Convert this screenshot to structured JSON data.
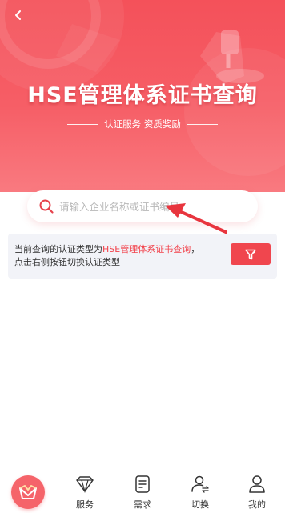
{
  "header": {
    "title": "HSE管理体系证书查询",
    "subtitle": "认证服务 资质奖励",
    "back_icon": "back-arrow-icon"
  },
  "search": {
    "placeholder": "请输入企业名称或证书编号",
    "value": ""
  },
  "notice": {
    "prefix": "当前查询的认证类型为",
    "highlight": "HSE管理体系证书查询",
    "suffix": "，",
    "line2": "点击右侧按钮切换认证类型",
    "filter_icon": "filter-icon"
  },
  "tabbar": {
    "items": [
      {
        "label": "",
        "icon": "home-logo-icon"
      },
      {
        "label": "服务",
        "icon": "diamond-icon"
      },
      {
        "label": "需求",
        "icon": "document-icon"
      },
      {
        "label": "切换",
        "icon": "switch-user-icon"
      },
      {
        "label": "我的",
        "icon": "user-icon"
      }
    ]
  },
  "colors": {
    "brand_red": "#f0464e",
    "hero_top": "#f4515a",
    "highlight_text": "#f2424b",
    "notice_bg": "#f2f3f8"
  }
}
